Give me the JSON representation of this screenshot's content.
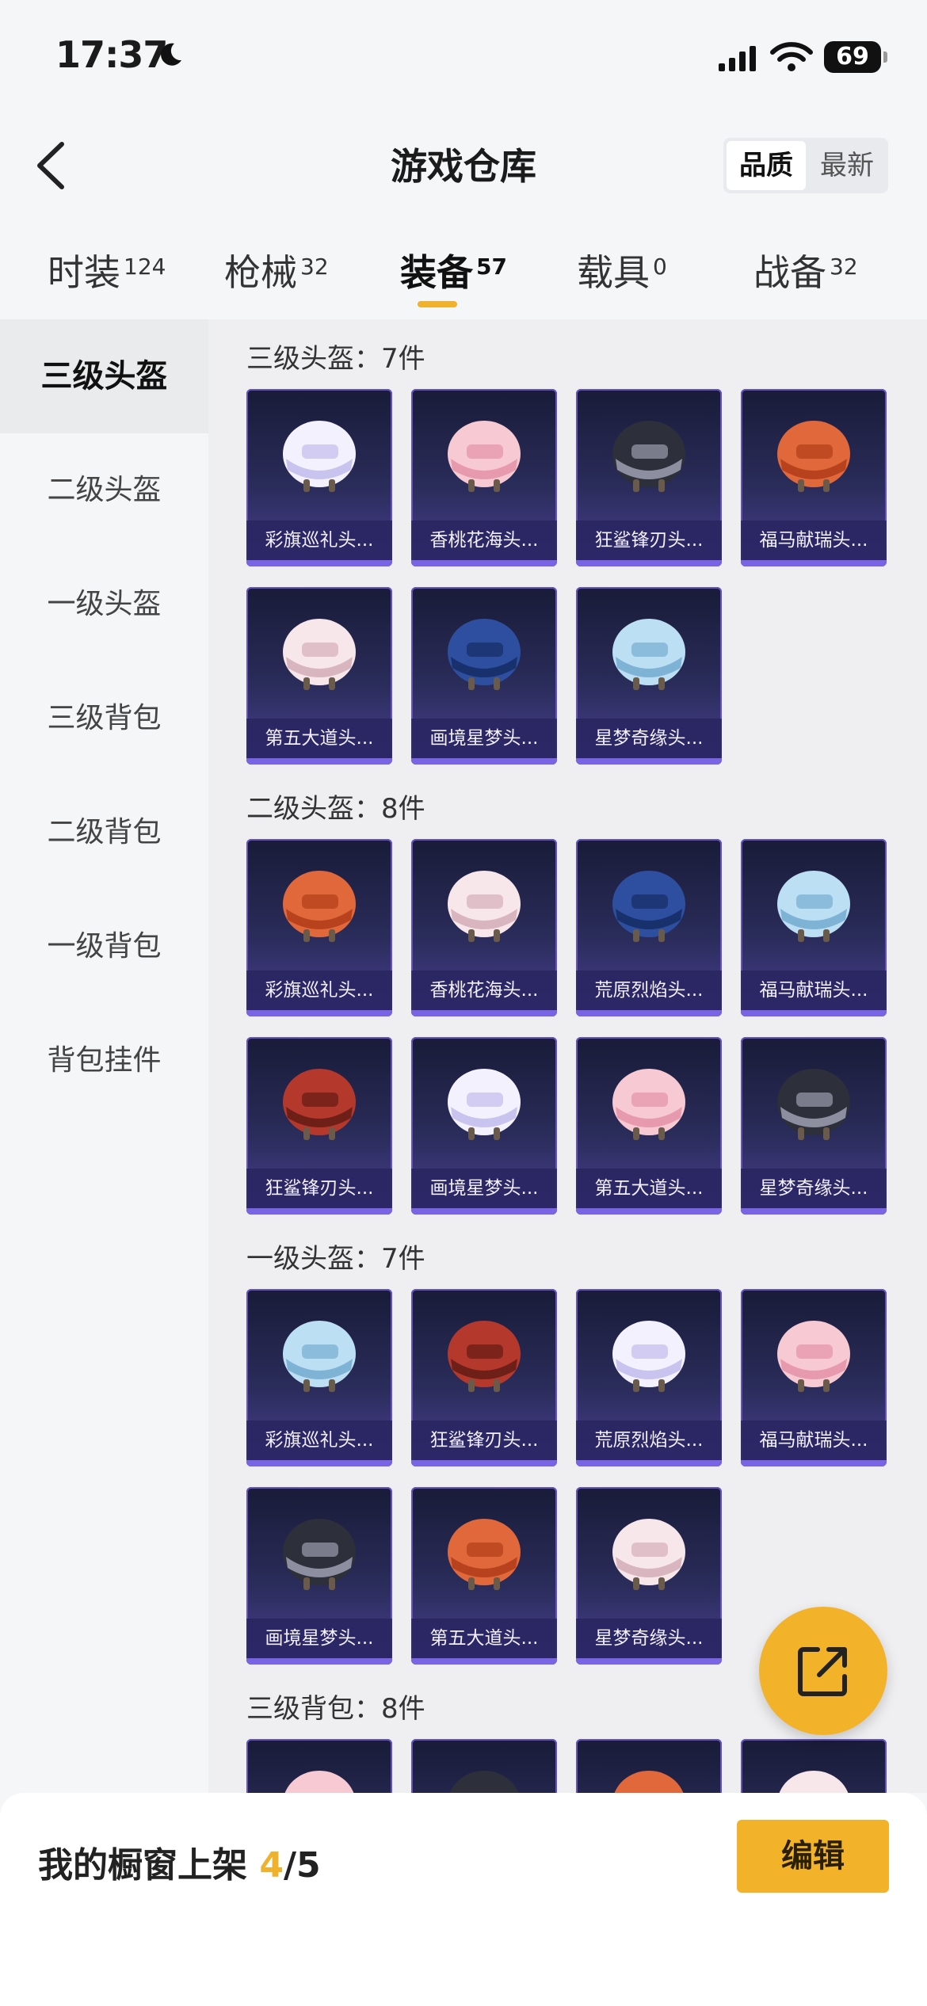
{
  "status": {
    "time": "17:37",
    "battery": "69"
  },
  "nav": {
    "title": "游戏仓库",
    "sort_active": "品质",
    "sort_inactive": "最新"
  },
  "tabs": [
    {
      "label": "时装",
      "count": "124"
    },
    {
      "label": "枪械",
      "count": "32"
    },
    {
      "label": "装备",
      "count": "57"
    },
    {
      "label": "载具",
      "count": "0"
    },
    {
      "label": "战备",
      "count": "32"
    }
  ],
  "sidebar": [
    "三级头盔",
    "二级头盔",
    "一级头盔",
    "三级背包",
    "二级背包",
    "一级背包",
    "背包挂件"
  ],
  "sections": [
    {
      "title": "三级头盔：7件",
      "items": [
        "彩旗巡礼头...",
        "香桃花海头...",
        "狂鲨锋刃头...",
        "福马献瑞头...",
        "第五大道头...",
        "画境星梦头...",
        "星梦奇缘头..."
      ]
    },
    {
      "title": "二级头盔：8件",
      "items": [
        "彩旗巡礼头...",
        "香桃花海头...",
        "荒原烈焰头...",
        "福马献瑞头...",
        "狂鲨锋刃头...",
        "画境星梦头...",
        "第五大道头...",
        "星梦奇缘头..."
      ]
    },
    {
      "title": "一级头盔：7件",
      "items": [
        "彩旗巡礼头...",
        "狂鲨锋刃头...",
        "荒原烈焰头...",
        "福马献瑞头...",
        "画境星梦头...",
        "第五大道头...",
        "星梦奇缘头..."
      ]
    },
    {
      "title": "三级背包：8件",
      "items": [
        "",
        "",
        "",
        ""
      ]
    }
  ],
  "bottom": {
    "shelf_label": "我的橱窗上架",
    "shelf_current": "4",
    "shelf_total": "/5",
    "edit_label": "编辑"
  },
  "colors": {
    "accent": "#f2b32b",
    "card_border": "#6352c4"
  },
  "icons": {
    "back": "chevron-left-icon",
    "fab": "share-icon",
    "moon": "moon-icon",
    "wifi": "wifi-icon",
    "signal": "signal-icon"
  }
}
